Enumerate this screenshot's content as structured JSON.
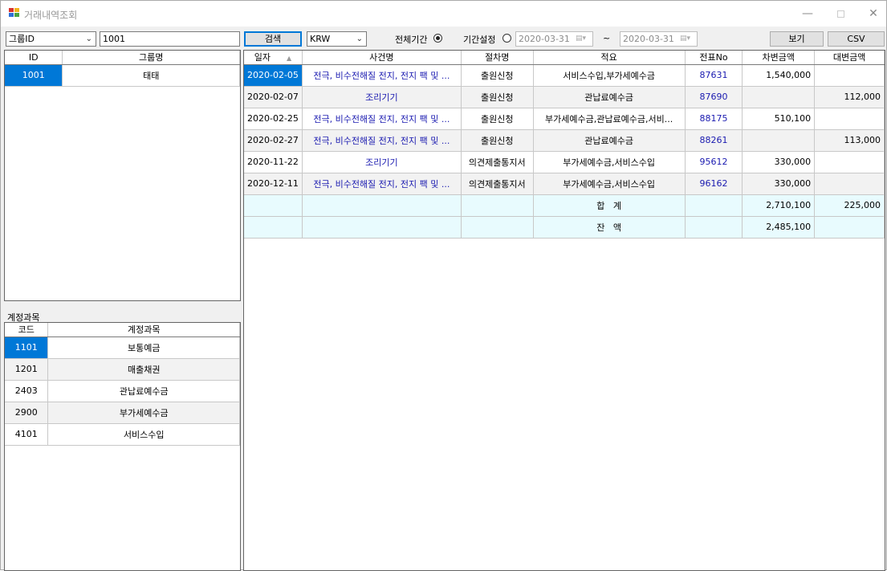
{
  "window": {
    "title": "거래내역조회",
    "minimize_icon": "minimize-icon",
    "maximize_icon": "maximize-icon",
    "close_icon": "close-icon"
  },
  "toolbar": {
    "group_select": "그룹ID",
    "group_value": "1001",
    "search_label": "검색",
    "currency": "KRW",
    "all_period_label": "전체기간",
    "period_setting_label": "기간설정",
    "date_from": "2020-03-31",
    "tilde": "~",
    "date_to": "2020-03-31",
    "view_label": "보기",
    "csv_label": "CSV"
  },
  "group_grid": {
    "headers": [
      "ID",
      "그룹명"
    ],
    "rows": [
      {
        "id": "1001",
        "name": "태태"
      }
    ]
  },
  "account_section_label": "계정과목",
  "account_grid": {
    "headers": [
      "코드",
      "계정과목"
    ],
    "rows": [
      {
        "code": "1101",
        "name": "보통예금"
      },
      {
        "code": "1201",
        "name": "매출채권"
      },
      {
        "code": "2403",
        "name": "관납료예수금"
      },
      {
        "code": "2900",
        "name": "부가세예수금"
      },
      {
        "code": "4101",
        "name": "서비스수입"
      }
    ]
  },
  "tx_grid": {
    "headers": [
      "일자",
      "사건명",
      "절차명",
      "적요",
      "전표No",
      "차변금액",
      "대변금액"
    ],
    "rows": [
      {
        "date": "2020-02-05",
        "case": "전극, 비수전해질 전지, 전지 팩 및 ...",
        "proc": "출원신청",
        "memo": "서비스수입,부가세예수금",
        "no": "87631",
        "debit": "1,540,000",
        "credit": ""
      },
      {
        "date": "2020-02-07",
        "case": "조리기기",
        "proc": "출원신청",
        "memo": "관납료예수금",
        "no": "87690",
        "debit": "",
        "credit": "112,000"
      },
      {
        "date": "2020-02-25",
        "case": "전극, 비수전해질 전지, 전지 팩 및 ...",
        "proc": "출원신청",
        "memo": "부가세예수금,관납료예수금,서비...",
        "no": "88175",
        "debit": "510,100",
        "credit": ""
      },
      {
        "date": "2020-02-27",
        "case": "전극, 비수전해질 전지, 전지 팩 및 ...",
        "proc": "출원신청",
        "memo": "관납료예수금",
        "no": "88261",
        "debit": "",
        "credit": "113,000"
      },
      {
        "date": "2020-11-22",
        "case": "조리기기",
        "proc": "의견제출통지서",
        "memo": "부가세예수금,서비스수입",
        "no": "95612",
        "debit": "330,000",
        "credit": ""
      },
      {
        "date": "2020-12-11",
        "case": "전극, 비수전해질 전지, 전지 팩 및 ...",
        "proc": "의견제출통지서",
        "memo": "부가세예수금,서비스수입",
        "no": "96162",
        "debit": "330,000",
        "credit": ""
      }
    ],
    "total": {
      "label": "합   계",
      "debit": "2,710,100",
      "credit": "225,000"
    },
    "balance": {
      "label": "잔   액",
      "debit": "2,485,100",
      "credit": ""
    }
  }
}
